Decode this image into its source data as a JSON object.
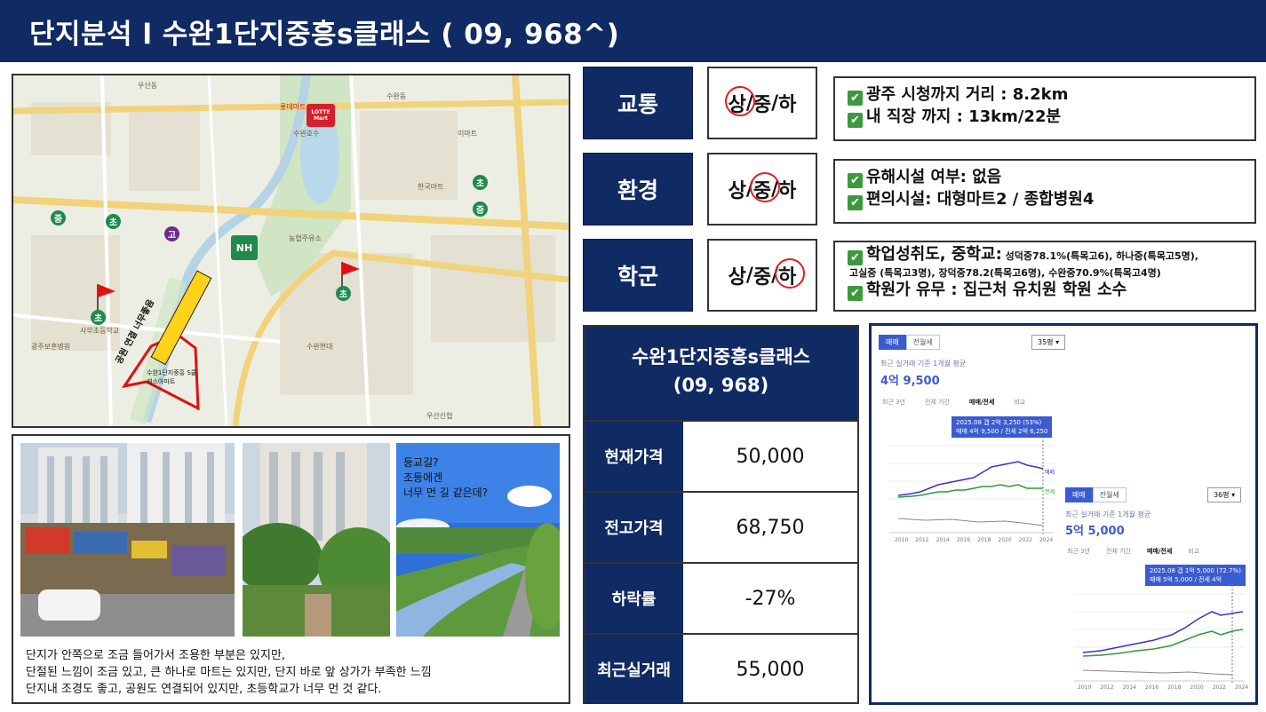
{
  "header": {
    "title": "단지분석 l  수완1단지중흥s클래스 ( 09, 968^)"
  },
  "map": {
    "labels": [
      "우산동",
      "수완동",
      "수완호수",
      "농협주유소",
      "광주보훈병원",
      "사부초등학교",
      "우산신협",
      "한국마트",
      "이마트",
      "수완현대",
      "롯데마트"
    ],
    "route_label": "공원 연결 너무좋음",
    "complex_label": "수완1단지중흥 S클래스아파트",
    "lotte_label": "LOTTE Mart",
    "nh_label": "NH",
    "school_marks": [
      "초",
      "중",
      "고"
    ]
  },
  "photos": {
    "note": "등교길?\n조등에겐\n너무 먼 길 같은데?",
    "description": "단지가 안쪽으로 조금 들어가서 조용한 부분은 있지만,\n단절된 느낌이 조금 있고, 큰 하나로 마트는 있지만, 단지 바로 앞 상가가 부족한 느낌\n단지내 조경도 좋고, 공원도 연결되어 있지만, 초등학교가 너무 먼 것 같다."
  },
  "ratings": [
    {
      "category": "교통",
      "grades": [
        "상",
        "중",
        "하"
      ],
      "selected": 0,
      "lines": [
        "광주 시청까지 거리 : 8.2km",
        "내 직장 까지 : 13km/22분"
      ]
    },
    {
      "category": "환경",
      "grades": [
        "상",
        "중",
        "하"
      ],
      "selected": 1,
      "lines": [
        "유해시설 여부: 없음",
        "편의시설: 대형마트2 / 종합병원4"
      ]
    },
    {
      "category": "학군",
      "grades": [
        "상",
        "중",
        "하"
      ],
      "selected": 2,
      "line1_main": "학업성취도, 중학교:",
      "line1_small": " 성덕중78.1%(특목고6), 하나중(특목고5명),",
      "line2_small": "고실중 (특목고3명), 장덕중78.2(특목고6명), 수완중70.9%(특목고4명)",
      "line3": "학원가 유무 : 집근처 유치원 학원 소수"
    }
  ],
  "price_table": {
    "title_line1": "수완1단지중흥s클래스",
    "title_line2": "(09, 968)",
    "rows": [
      {
        "label": "현재가격",
        "value": "50,000"
      },
      {
        "label": "전고가격",
        "value": "68,750"
      },
      {
        "label": "하락률",
        "value": "-27%"
      },
      {
        "label": "최근실거래",
        "value": "55,000"
      }
    ]
  },
  "chart_panel": {
    "tab_sale": "매매",
    "tab_jeonse": "전월세",
    "dropdown": "35평",
    "caption": "최근 실거래 기준 1개월 평균",
    "price": "4억 9,500",
    "range_tabs": [
      "최근 3년",
      "전체 기간",
      "매매/전세",
      "비교"
    ],
    "tooltip_line1": "2025.08  갭 2억 3,250 (53%)",
    "tooltip_line2": "매매 4억 9,500 / 전세 2억 6,250",
    "x_ticks": [
      "2010",
      "2012",
      "2014",
      "2016",
      "2018",
      "2020",
      "2022",
      "2024"
    ],
    "legend_sale": "매매",
    "legend_jeonse": "전세",
    "sub": {
      "tab_sale": "매매",
      "tab_jeonse": "전월세",
      "dropdown": "36평",
      "caption": "최근 실거래 기준 1개월 평균",
      "price": "5억 5,000",
      "range_tabs": [
        "최근 3년",
        "전체 기간",
        "매매/전세",
        "비교"
      ],
      "tooltip_line1": "2025.08  갭 1억 5,000 (72.7%)",
      "tooltip_line2": "매매 5억 5,000 / 전세 4억",
      "x_ticks": [
        "2010",
        "2012",
        "2014",
        "2016",
        "2018",
        "2020",
        "2022",
        "2024"
      ]
    }
  },
  "colors": {
    "navy": "#102a63",
    "red_circle": "#e02020",
    "check_green": "#3c9a3c",
    "sale_line": "#3b33c4",
    "jeonse_line": "#2e9a3a"
  },
  "icons": [
    "check-icon",
    "flag-icon",
    "school-icon"
  ]
}
